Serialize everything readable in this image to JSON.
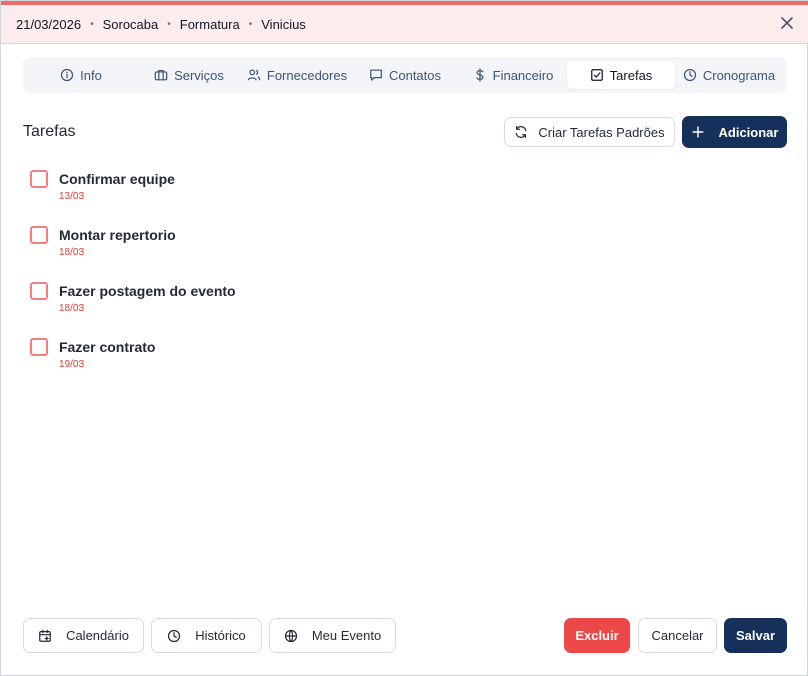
{
  "header": {
    "date": "21/03/2026",
    "city": "Sorocaba",
    "event_type": "Formatura",
    "client": "Vinicius",
    "separator": "•",
    "close_icon": "close-icon"
  },
  "tabs": [
    {
      "label": "Info",
      "icon": "info-icon"
    },
    {
      "label": "Serviços",
      "icon": "briefcase-icon"
    },
    {
      "label": "Fornecedores",
      "icon": "users-icon"
    },
    {
      "label": "Contatos",
      "icon": "chat-icon"
    },
    {
      "label": "Financeiro",
      "icon": "dollar-icon"
    },
    {
      "label": "Tarefas",
      "icon": "checkbox-icon",
      "active": true
    },
    {
      "label": "Cronograma",
      "icon": "clock-icon"
    }
  ],
  "main": {
    "title": "Tarefas",
    "default_tasks_label": "Criar Tarefas Padrões",
    "add_label": "Adicionar",
    "tasks": [
      {
        "title": "Confirmar equipe",
        "date": "13/03",
        "done": false
      },
      {
        "title": "Montar repertorio",
        "date": "18/03",
        "done": false
      },
      {
        "title": "Fazer postagem do evento",
        "date": "18/03",
        "done": false
      },
      {
        "title": "Fazer contrato",
        "date": "19/03",
        "done": false
      }
    ]
  },
  "footer": {
    "calendar_label": "Calendário",
    "history_label": "Histórico",
    "my_event_label": "Meu Evento",
    "delete_label": "Excluir",
    "cancel_label": "Cancelar",
    "save_label": "Salvar"
  },
  "colors": {
    "accent": "#15305a",
    "danger": "#ec4848",
    "header_bg": "#fdecec",
    "checkbox_border": "#f08080",
    "due_date": "#e53e3e"
  }
}
